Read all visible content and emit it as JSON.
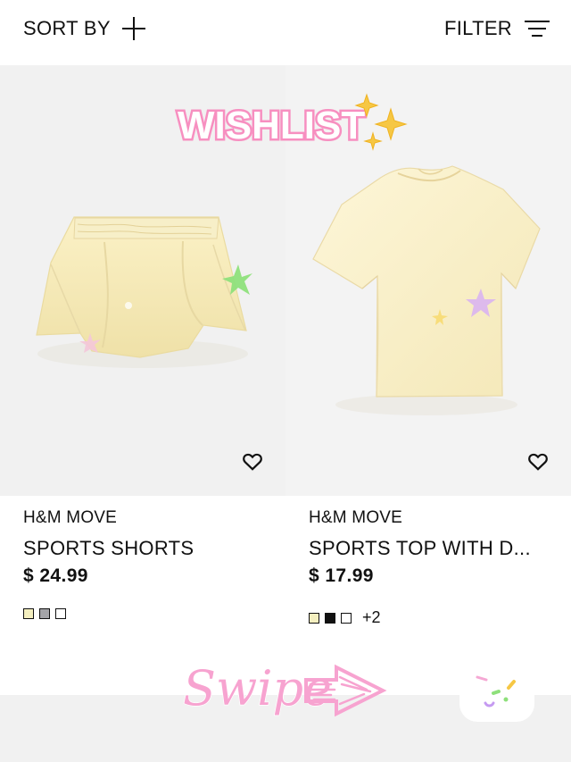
{
  "toolbar": {
    "sort_label": "SORT BY",
    "filter_label": "FILTER"
  },
  "stickers": {
    "wishlist": "WISHLIST",
    "swipe": "Swipe"
  },
  "products": [
    {
      "brand": "H&M MOVE",
      "title": "SPORTS SHORTS",
      "price": "$ 24.99",
      "swatches": [
        "cream",
        "gray",
        "white"
      ],
      "extra_colors": ""
    },
    {
      "brand": "H&M MOVE",
      "title": "SPORTS TOP WITH D...",
      "price": "$ 17.99",
      "swatches": [
        "cream",
        "black",
        "white"
      ],
      "extra_colors": "+2"
    }
  ],
  "colors": {
    "page_bg": "#ffffff",
    "card_bg": "#f1f1f1",
    "text": "#111111",
    "sticker_pink": "#f78fc0",
    "sticker_gold": "#f6c744",
    "shorts": "#f6ebb8",
    "tee": "#fbf0c8",
    "confetti_green": "#8ee07b"
  }
}
